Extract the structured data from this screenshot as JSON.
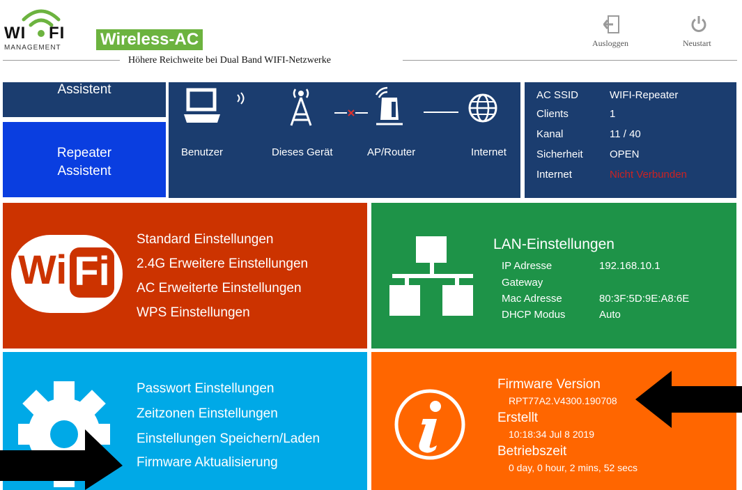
{
  "header": {
    "logo_wi": "WI",
    "logo_fi": "FI",
    "logo_management": "MANAGEMENT",
    "brand_badge": "Wireless-AC",
    "tagline": "Höhere Reichweite bei Dual Band WIFI-Netzwerke",
    "logout_label": "Ausloggen",
    "restart_label": "Neustart"
  },
  "wizard": {
    "top_label": "Assistent",
    "repeater_line1": "Repeater",
    "repeater_line2": "Assistent"
  },
  "topology": {
    "labels": [
      "Benutzer",
      "Dieses Gerät",
      "AP/Router",
      "Internet"
    ]
  },
  "status": {
    "rows": [
      {
        "label": "AC SSID",
        "value": "WIFI-Repeater"
      },
      {
        "label": "Clients",
        "value": "1"
      },
      {
        "label": "Kanal",
        "value": "11 / 40"
      },
      {
        "label": "Sicherheit",
        "value": "OPEN"
      },
      {
        "label": "Internet",
        "value": "Nicht Verbunden"
      }
    ]
  },
  "wifi_tile": {
    "logo_wi": "Wi",
    "logo_fi": "Fi",
    "links": [
      "Standard Einstellungen",
      "2.4G Erweitere Einstellungen",
      "AC Erweiterte Einstellungen",
      "WPS Einstellungen"
    ]
  },
  "lan_tile": {
    "title": "LAN-Einstellungen",
    "rows": [
      {
        "label": "IP Adresse",
        "value": "192.168.10.1"
      },
      {
        "label": "Gateway",
        "value": ""
      },
      {
        "label": "Mac Adresse",
        "value": "80:3F:5D:9E:A8:6E"
      },
      {
        "label": "DHCP Modus",
        "value": "Auto"
      }
    ]
  },
  "system_tile": {
    "links": [
      "Passwort Einstellungen",
      "Zeitzonen Einstellungen",
      "Einstellungen Speichern/Laden",
      "Firmware Aktualisierung"
    ]
  },
  "info_tile": {
    "firmware_title": "Firmware Version",
    "firmware_value": "RPT77A2.V4300.190708",
    "built_title": "Erstellt",
    "built_value": "10:18:34 Jul 8 2019",
    "uptime_title": "Betriebszeit",
    "uptime_value": "0 day, 0 hour, 2 mins, 52 secs"
  },
  "colors": {
    "navy": "#1b3d6f",
    "blue": "#0a3ee0",
    "red": "#cc3300",
    "green": "#1e9348",
    "cyan": "#00a9e7",
    "orange": "#ff6600",
    "brand_green": "#6cb33f",
    "status_red": "#cc2222"
  }
}
